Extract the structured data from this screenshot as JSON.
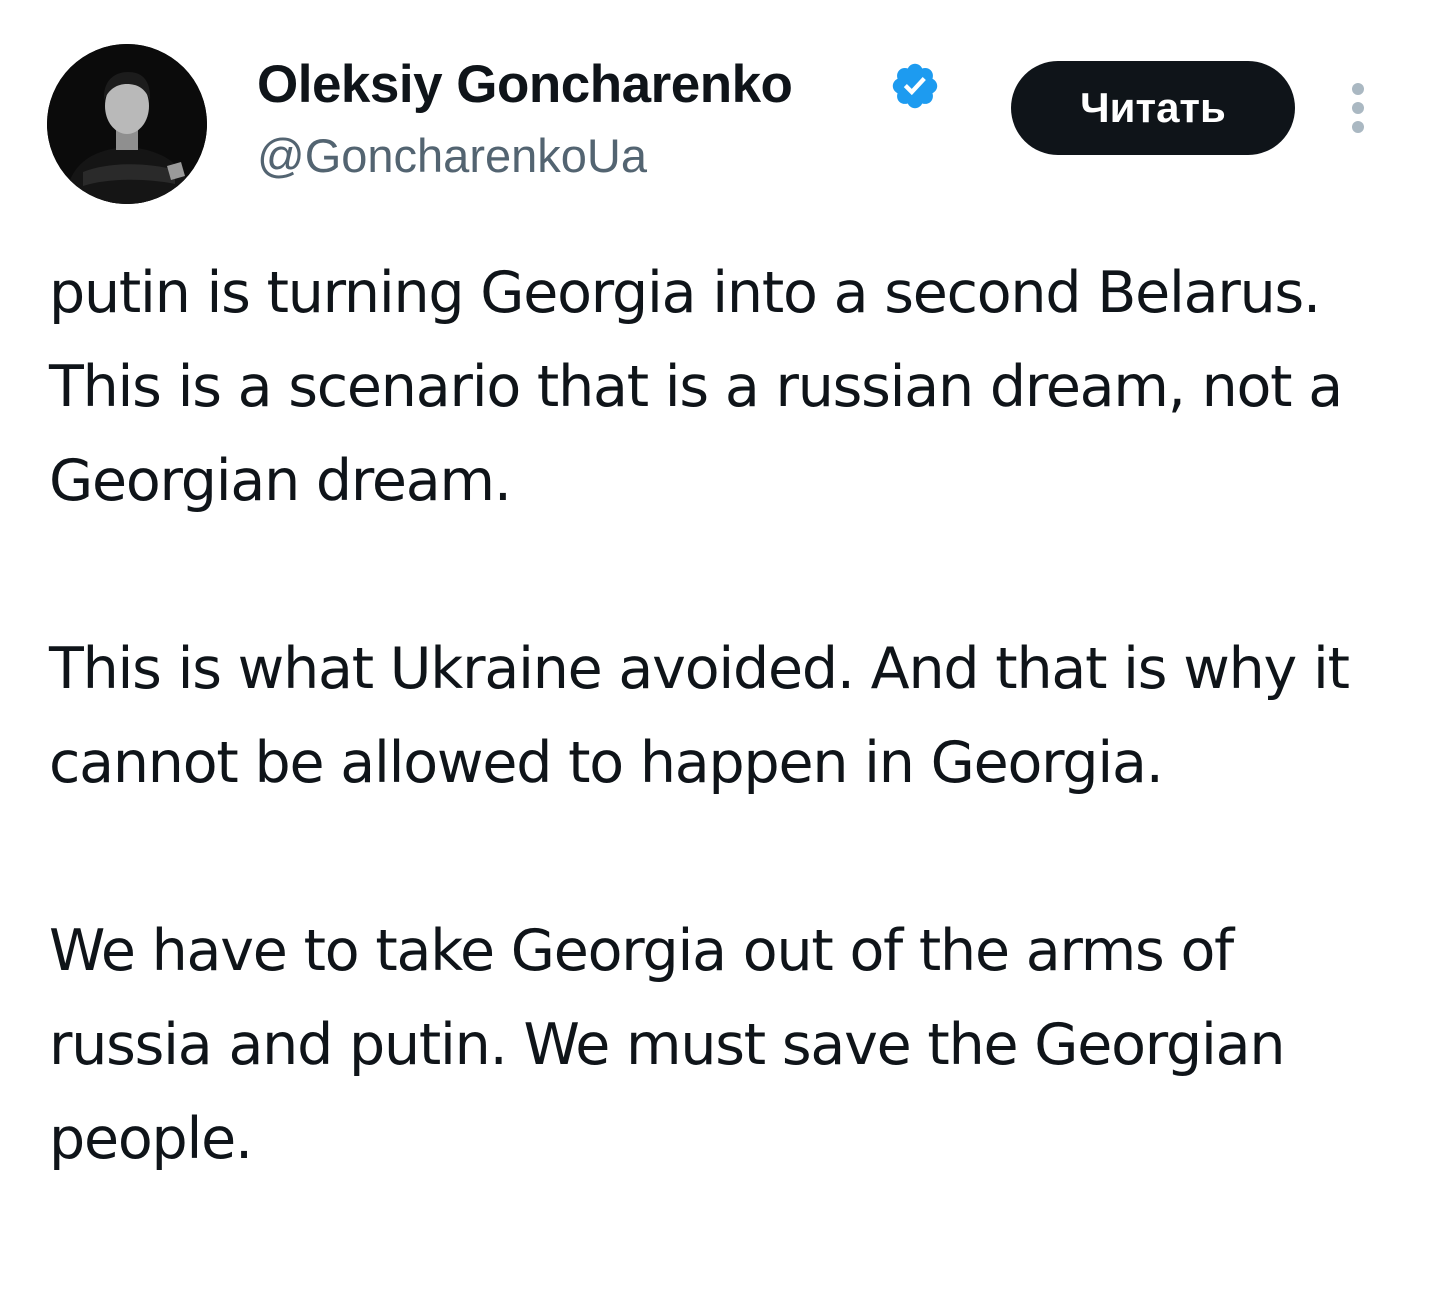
{
  "author": {
    "display_name": "Oleksiy Goncharenko",
    "handle": "@GoncharenkoUa",
    "verified_icon": "verified-badge-icon",
    "avatar_icon": "avatar"
  },
  "actions": {
    "follow_label": "Читать",
    "more_icon": "more-vertical-icon"
  },
  "colors": {
    "text": "#0f1419",
    "secondary_text": "#536471",
    "verified_blue": "#1d9bf0",
    "button_bg": "#0f1419",
    "button_text": "#ffffff",
    "more_dots": "#aab8c2"
  },
  "tweet": {
    "paragraphs": [
      "putin is turning Georgia into a second Belarus. This is a scenario that is a russian dream, not a Georgian dream.",
      "This is what Ukraine avoided. And that is why it cannot be allowed to happen in Georgia.",
      "We have to take Georgia out of the arms of russia and putin. We must save the Georgian people."
    ]
  }
}
